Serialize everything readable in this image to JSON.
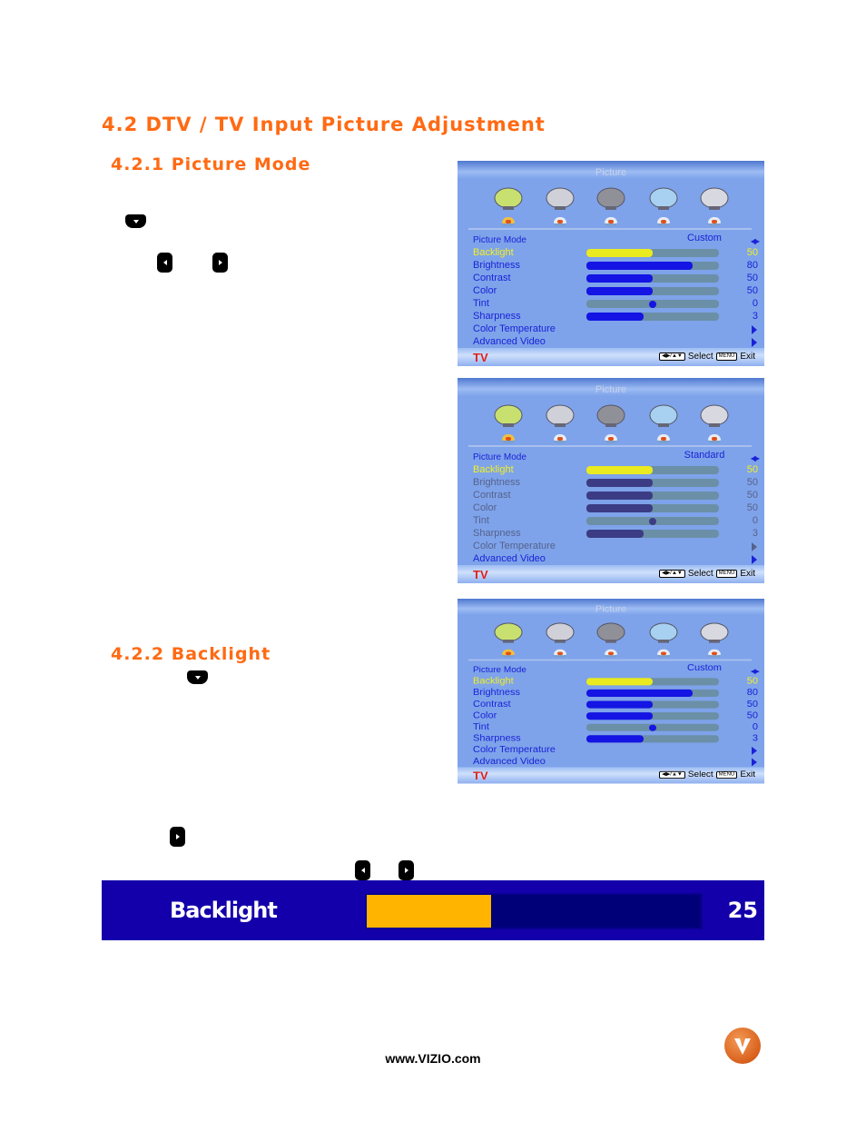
{
  "headings": {
    "section": "4.2 DTV / TV Input Picture Adjustment",
    "picture_mode": "4.2.1 Picture Mode",
    "backlight": "4.2.2 Backlight"
  },
  "remote_buttons": [
    "down",
    "left",
    "right",
    "down",
    "right",
    "left",
    "right"
  ],
  "menus": [
    {
      "title": "Picture",
      "mode_label": "Picture Mode",
      "mode_value": "Custom",
      "dimmed": false,
      "rows": [
        {
          "label": "Backlight",
          "value": "50",
          "type": "bar",
          "level": 50,
          "highlight": true
        },
        {
          "label": "Brightness",
          "value": "80",
          "type": "bar",
          "level": 80
        },
        {
          "label": "Contrast",
          "value": "50",
          "type": "bar",
          "level": 50
        },
        {
          "label": "Color",
          "value": "50",
          "type": "bar",
          "level": 50
        },
        {
          "label": "Tint",
          "value": "0",
          "type": "dot",
          "level": 0
        },
        {
          "label": "Sharpness",
          "value": "3",
          "type": "bar",
          "level": 3
        },
        {
          "label": "Color Temperature",
          "type": "arrow"
        },
        {
          "label": "Advanced Video",
          "type": "arrow"
        }
      ]
    },
    {
      "title": "Picture",
      "mode_label": "Picture Mode",
      "mode_value": "Standard",
      "dimmed": true,
      "rows": [
        {
          "label": "Backlight",
          "value": "50",
          "type": "bar",
          "level": 50,
          "highlight": true
        },
        {
          "label": "Brightness",
          "value": "50",
          "type": "bar",
          "level": 50
        },
        {
          "label": "Contrast",
          "value": "50",
          "type": "bar",
          "level": 50
        },
        {
          "label": "Color",
          "value": "50",
          "type": "bar",
          "level": 50
        },
        {
          "label": "Tint",
          "value": "0",
          "type": "dot",
          "level": 0
        },
        {
          "label": "Sharpness",
          "value": "3",
          "type": "bar",
          "level": 3
        },
        {
          "label": "Color Temperature",
          "type": "arrow"
        },
        {
          "label": "Advanced Video",
          "type": "arrow",
          "active": true
        }
      ]
    },
    {
      "title": "Picture",
      "mode_label": "Picture Mode",
      "mode_value": "Custom",
      "dimmed": false,
      "rows": [
        {
          "label": "Backlight",
          "value": "50",
          "type": "bar",
          "level": 50,
          "highlight": true
        },
        {
          "label": "Brightness",
          "value": "80",
          "type": "bar",
          "level": 80
        },
        {
          "label": "Contrast",
          "value": "50",
          "type": "bar",
          "level": 50
        },
        {
          "label": "Color",
          "value": "50",
          "type": "bar",
          "level": 50
        },
        {
          "label": "Tint",
          "value": "0",
          "type": "dot",
          "level": 0
        },
        {
          "label": "Sharpness",
          "value": "3",
          "type": "bar",
          "level": 3
        },
        {
          "label": "Color Temperature",
          "type": "arrow"
        },
        {
          "label": "Advanced Video",
          "type": "arrow"
        }
      ]
    }
  ],
  "menu_icons": [
    "picture-icon",
    "audio-icon",
    "tv-icon",
    "setup-icon",
    "parental-icon"
  ],
  "menu_footer": {
    "input": "TV",
    "select": "Select",
    "menu_key": "MENU",
    "exit": "Exit"
  },
  "backlight_bar": {
    "label": "Backlight",
    "value": "25",
    "level": 25,
    "colors": {
      "background": "#1400aa",
      "fill": "#ffb400",
      "track": "#000078"
    }
  },
  "footer": {
    "url": "www.VIZIO.com"
  },
  "colors": {
    "heading": "#ff6a13",
    "menu_bg": "#7ea3ea",
    "menu_text": "#1a22d8",
    "highlight": "#f2f020"
  }
}
